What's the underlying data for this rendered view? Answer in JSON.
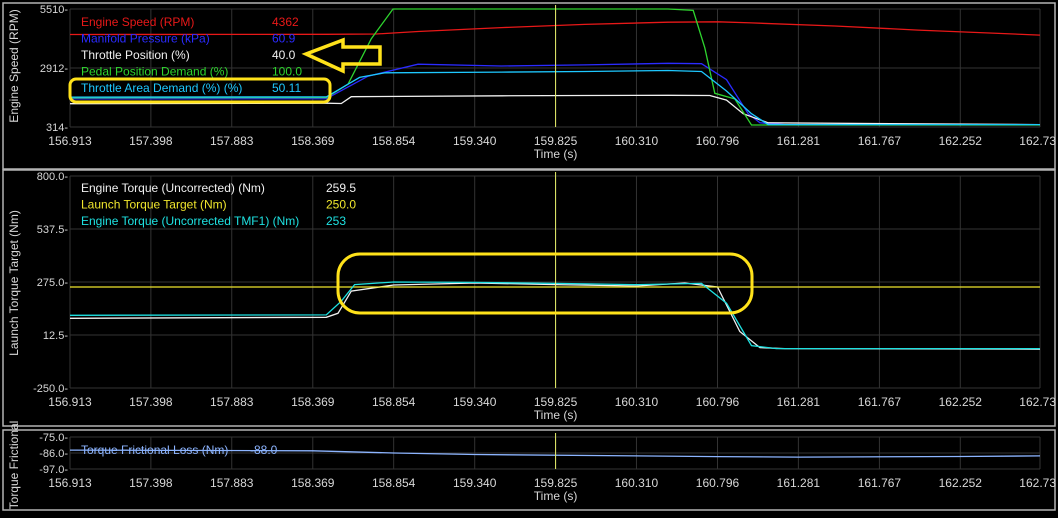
{
  "colors": {
    "background": "#000000",
    "panel_border": "#b4b4b4",
    "grid": "#333333",
    "tick_text": "#d8d8d8",
    "cursor": "#e8f06a",
    "annotation": "#ffe21a"
  },
  "cursor": {
    "x": 159.825
  },
  "time_axis": {
    "label": "Time (s)",
    "xlim": [
      156.913,
      162.73
    ],
    "tick_values": [
      156.913,
      157.398,
      157.883,
      158.369,
      158.854,
      159.34,
      159.825,
      160.31,
      160.796,
      161.281,
      161.767,
      162.252,
      162.73
    ],
    "tick_labels": [
      "156.913",
      "157.398",
      "157.883",
      "158.369",
      "158.854",
      "159.340",
      "159.825",
      "160.310",
      "160.796",
      "161.281",
      "161.767",
      "162.252",
      "162.73"
    ]
  },
  "chart_data": [
    {
      "type": "line",
      "ylabel": "Engine Speed (RPM)",
      "ylim": [
        314,
        5510
      ],
      "y_tick_values": [
        314,
        2912,
        5510
      ],
      "y_tick_labels": [
        "314-",
        "2912-",
        "5510-"
      ],
      "grid": true,
      "legend_position": "top-left",
      "series": [
        {
          "name": "Engine Speed (RPM)",
          "value_label": "4362",
          "color": "#e81818",
          "x": [
            156.913,
            158.45,
            158.75,
            159.0,
            159.5,
            160.0,
            160.5,
            160.8,
            161.0,
            161.5,
            162.0,
            162.73
          ],
          "y": [
            4385,
            4395,
            4410,
            4520,
            4690,
            4830,
            4930,
            4945,
            4900,
            4760,
            4580,
            4362
          ]
        },
        {
          "name": "Manifold Pressure (kPa)",
          "value_label": "60.9",
          "color": "#2b2bff",
          "x": [
            156.913,
            158.45,
            158.7,
            159.0,
            159.5,
            160.0,
            160.5,
            160.7,
            160.85,
            160.98,
            161.05,
            161.2,
            162.73
          ],
          "y": [
            1550,
            1560,
            2550,
            3080,
            3000,
            3050,
            3120,
            3100,
            2400,
            900,
            500,
            420,
            420
          ]
        },
        {
          "name": "Throttle Position (%)",
          "value_label": "40.0",
          "color": "#f0f0f0",
          "x": [
            156.913,
            158.45,
            158.54,
            158.6,
            159.5,
            160.0,
            160.5,
            160.75,
            160.85,
            160.95,
            161.1,
            162.73
          ],
          "y": [
            1340,
            1360,
            1350,
            1650,
            1690,
            1700,
            1710,
            1700,
            1500,
            900,
            500,
            420
          ]
        },
        {
          "name": "Pedal Position Demand (%)",
          "value_label": "100.0",
          "color": "#2ed42e",
          "x": [
            156.913,
            158.45,
            158.58,
            158.72,
            158.85,
            159.5,
            160.0,
            160.5,
            160.65,
            160.72,
            160.78,
            160.9,
            161.0,
            162.73
          ],
          "y": [
            1600,
            1610,
            2200,
            4200,
            5510,
            5510,
            5510,
            5510,
            5450,
            3800,
            1800,
            1550,
            400,
            400
          ]
        },
        {
          "name": "Throttle Area Demand  (%) (%)",
          "value_label": "50.11",
          "color": "#1ec8ff",
          "x": [
            156.913,
            158.45,
            158.65,
            158.8,
            159.5,
            160.0,
            160.5,
            160.7,
            160.85,
            161.0,
            161.1,
            162.73
          ],
          "y": [
            1630,
            1640,
            2500,
            2700,
            2730,
            2760,
            2800,
            2760,
            1900,
            900,
            420,
            420
          ]
        }
      ]
    },
    {
      "type": "line",
      "ylabel": "Launch Torque Target (Nm)",
      "ylim": [
        -250.0,
        800.0
      ],
      "y_tick_values": [
        -250,
        12.5,
        275,
        537.5,
        800
      ],
      "y_tick_labels": [
        "-250.0-",
        "12.5-",
        "275.0-",
        "537.5-",
        "800.0-"
      ],
      "grid": true,
      "legend_position": "top-left",
      "series": [
        {
          "name": "Engine Torque (Uncorrected) (Nm)",
          "value_label": "259.5",
          "color": "#f0f0f0",
          "x": [
            156.913,
            158.45,
            158.52,
            158.6,
            158.854,
            159.34,
            159.825,
            160.31,
            160.6,
            160.796,
            160.93,
            161.05,
            161.2,
            162.73
          ],
          "y": [
            95,
            100,
            120,
            230,
            260,
            270,
            262,
            255,
            270,
            250,
            30,
            -50,
            -55,
            -58
          ]
        },
        {
          "name": "Launch Torque Target (Nm)",
          "value_label": "250.0",
          "color": "#f0e62d",
          "x": [
            156.913,
            162.73
          ],
          "y": [
            250,
            250
          ]
        },
        {
          "name": "Engine Torque (Uncorrected TMF1) (Nm)",
          "value_label": "253",
          "color": "#1ee1e1",
          "x": [
            156.913,
            158.45,
            158.54,
            158.62,
            158.854,
            159.34,
            159.825,
            160.31,
            160.7,
            160.85,
            161.0,
            161.15,
            162.73
          ],
          "y": [
            110,
            112,
            180,
            262,
            275,
            273,
            268,
            262,
            268,
            170,
            -40,
            -55,
            -55
          ]
        }
      ]
    },
    {
      "type": "line",
      "ylabel": "Torque Frictional",
      "ylim": [
        -97.0,
        -75.0
      ],
      "y_tick_values": [
        -75,
        -86,
        -97
      ],
      "y_tick_labels": [
        "-75.0-",
        "-86.0-",
        "-97.0-"
      ],
      "grid": true,
      "legend_position": "top-left",
      "series": [
        {
          "name": "Torque Frictional Loss (Nm)",
          "value_label": "-88.0",
          "color": "#8cb4ff",
          "x": [
            156.913,
            158.369,
            158.854,
            159.34,
            160.31,
            160.796,
            161.281,
            162.252,
            162.73
          ],
          "y": [
            -84,
            -84.5,
            -86,
            -87,
            -88,
            -88.5,
            -88.8,
            -88.4,
            -88
          ]
        }
      ]
    }
  ]
}
